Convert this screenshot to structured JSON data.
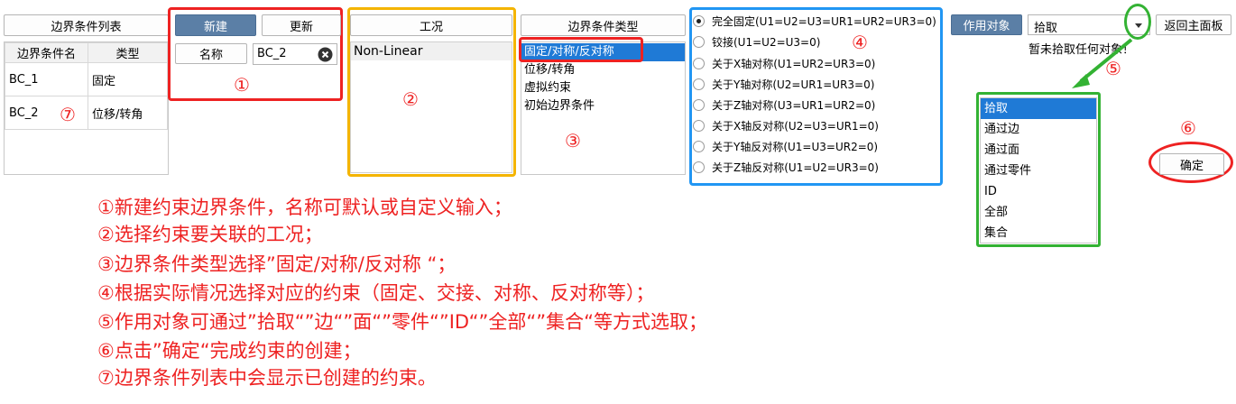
{
  "left": {
    "title_button": "边界条件列表",
    "columns": [
      "边界条件名",
      "类型"
    ],
    "rows": [
      {
        "name": "BC_1",
        "type": "固定"
      },
      {
        "name": "BC_2",
        "type": "位移/转角"
      }
    ]
  },
  "create": {
    "new_label": "新建",
    "update_label": "更新",
    "name_label": "名称",
    "name_value": "BC_2"
  },
  "condition": {
    "header": "工况",
    "items": [
      "Non-Linear"
    ]
  },
  "bc_type": {
    "header": "边界条件类型",
    "items": [
      "固定/对称/反对称",
      "位移/转角",
      "虚拟约束",
      "初始边界条件"
    ],
    "selected": 0
  },
  "constraints": {
    "options": [
      "完全固定(U1=U2=U3=UR1=UR2=UR3=0)",
      "铰接(U1=U2=U3=0)",
      "关于X轴对称(U1=UR2=UR3=0)",
      "关于Y轴对称(U2=UR1=UR3=0)",
      "关于Z轴对称(U3=UR1=UR2=0)",
      "关于X轴反对称(U2=U3=UR1=0)",
      "关于Y轴反对称(U1=U3=UR2=0)",
      "关于Z轴反对称(U1=U2=UR3=0)"
    ],
    "selected": 0
  },
  "target": {
    "label": "作用对象",
    "select_value": "拾取",
    "back_label": "返回主面板",
    "status": "暂未拾取任何对象！",
    "options": [
      "拾取",
      "通过边",
      "通过面",
      "通过零件",
      "ID",
      "全部",
      "集合"
    ],
    "selected": 0,
    "confirm_label": "确定"
  },
  "markers": [
    "①",
    "②",
    "③",
    "④",
    "⑤",
    "⑥",
    "⑦"
  ],
  "notes": [
    "①新建约束边界条件，名称可默认或自定义输入；",
    "②选择约束要关联的工况；",
    "③边界条件类型选择”固定/对称/反对称 “；",
    "④根据实际情况选择对应的约束（固定、交接、对称、反对称等）；",
    "⑤作用对象可通过”拾取“”边“”面“”零件“”ID“”全部“”集合“等方式选取；",
    "⑥点击”确定“完成约束的创建；",
    "⑦边界条件列表中会显示已创建的约束。"
  ],
  "colors": {
    "annotation_red": "#ee2222",
    "highlight_orange": "#f4b400",
    "highlight_blue": "#2196f3",
    "highlight_green": "#33b233",
    "selection_blue": "#1f7ad6",
    "button_blue": "#5b7fa6"
  }
}
